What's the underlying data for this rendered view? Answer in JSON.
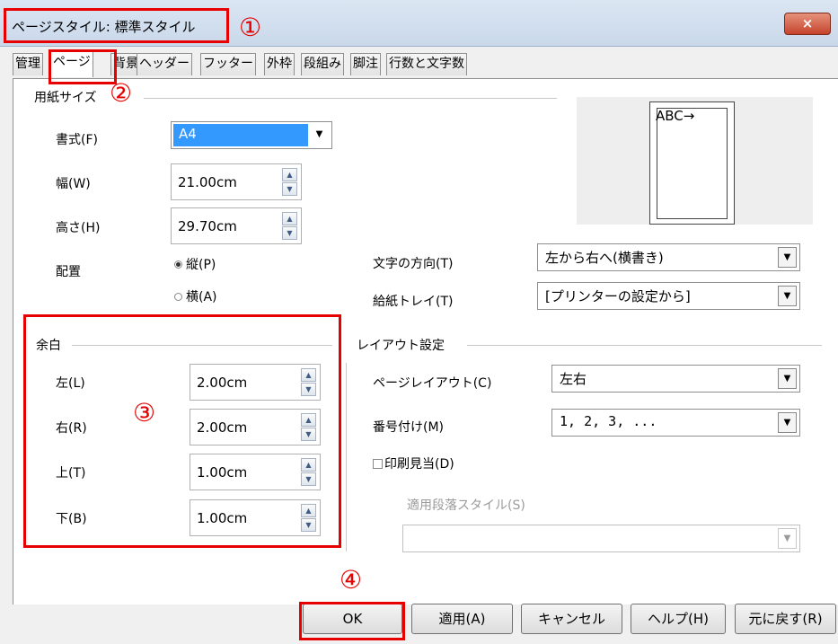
{
  "titlebar": {
    "title": "ページスタイル: 標準スタイル",
    "close_label": "×"
  },
  "tabs": [
    {
      "label": "管理"
    },
    {
      "label": "ページ"
    },
    {
      "label": "背景"
    },
    {
      "label": "ヘッダー"
    },
    {
      "label": "フッター"
    },
    {
      "label": "外枠"
    },
    {
      "label": "段組み"
    },
    {
      "label": "脚注"
    },
    {
      "label": "行数と文字数"
    }
  ],
  "paper": {
    "section_title": "用紙サイズ",
    "format_label": "書式(F)",
    "format_value": "A4",
    "width_label": "幅(W)",
    "width_value": "21.00cm",
    "height_label": "高さ(H)",
    "height_value": "29.70cm",
    "orientation_label": "配置",
    "portrait_label": "縦(P)",
    "landscape_label": "横(A)"
  },
  "preview": {
    "text": "ABC→"
  },
  "text_direction": {
    "label": "文字の方向(T)",
    "value": "左から右へ(横書き)"
  },
  "paper_tray": {
    "label": "給紙トレイ(T)",
    "value": "[プリンターの設定から]"
  },
  "margins": {
    "section_title": "余白",
    "left_label": "左(L)",
    "left_value": "2.00cm",
    "right_label": "右(R)",
    "right_value": "2.00cm",
    "top_label": "上(T)",
    "top_value": "1.00cm",
    "bottom_label": "下(B)",
    "bottom_value": "1.00cm"
  },
  "layout": {
    "section_title": "レイアウト設定",
    "page_layout_label": "ページレイアウト(C)",
    "page_layout_value": "左右",
    "numbering_label": "番号付け(M)",
    "numbering_value": "1, 2, 3, ...",
    "register_label": "印刷見当(D)",
    "ref_style_label": "適用段落スタイル(S)",
    "ref_style_value": ""
  },
  "buttons": {
    "ok": "OK",
    "apply": "適用(A)",
    "cancel": "キャンセル",
    "help": "ヘルプ(H)",
    "reset": "元に戻す(R)"
  },
  "annotations": {
    "m1": "①",
    "m2": "②",
    "m3": "③",
    "m4": "④"
  },
  "colors": {
    "annotation": "#e60000",
    "selection": "#3399ff"
  }
}
